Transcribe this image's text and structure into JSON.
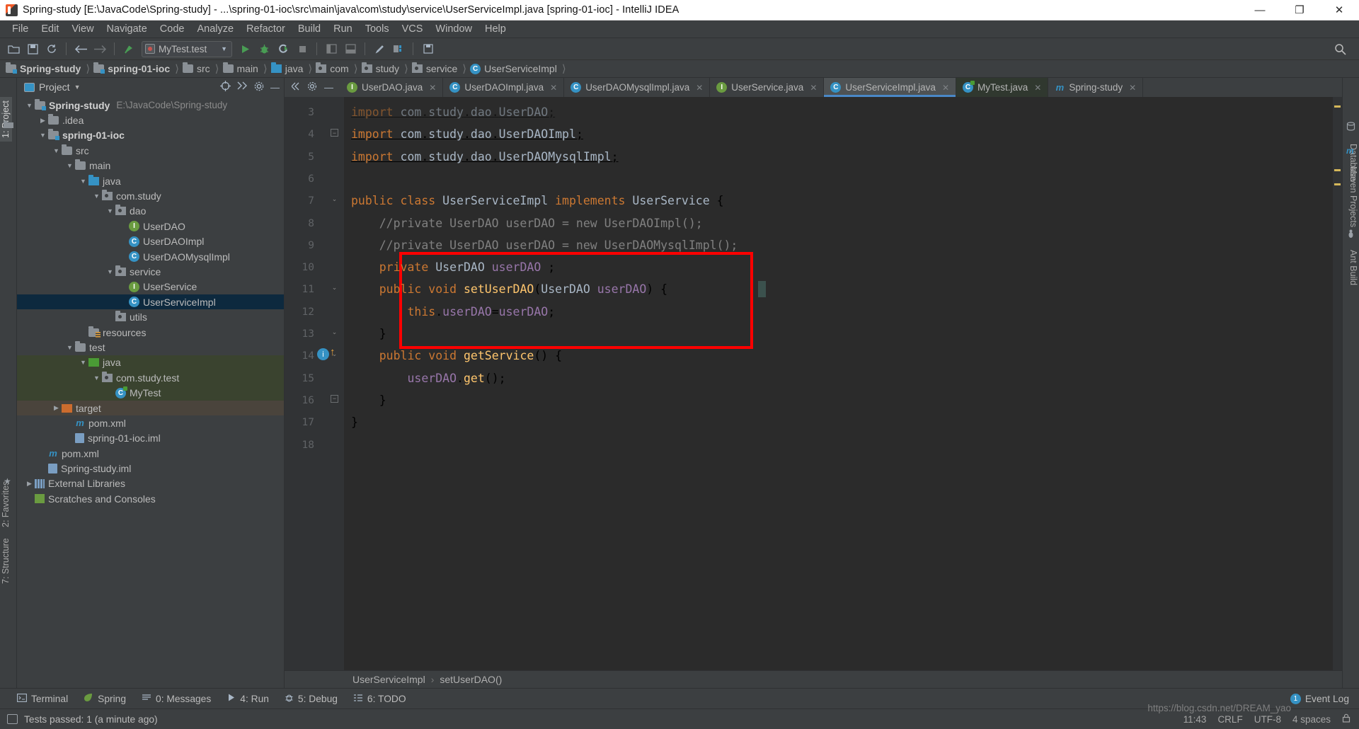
{
  "window": {
    "title": "Spring-study [E:\\JavaCode\\Spring-study] - ...\\spring-01-ioc\\src\\main\\java\\com\\study\\service\\UserServiceImpl.java [spring-01-ioc] - IntelliJ IDEA",
    "minimize": "—",
    "maximize": "❐",
    "close": "✕"
  },
  "menu": [
    "File",
    "Edit",
    "View",
    "Navigate",
    "Code",
    "Analyze",
    "Refactor",
    "Build",
    "Run",
    "Tools",
    "VCS",
    "Window",
    "Help"
  ],
  "toolbar": {
    "open_icon": "open-folder-icon",
    "save_icon": "save-icon",
    "sync_icon": "sync-icon",
    "back_icon": "back-arrow-icon",
    "forward_icon": "forward-arrow-icon",
    "update_icon": "vcs-update-icon",
    "run_config_label": "MyTest.test",
    "run_icon": "run-icon",
    "debug_icon": "debug-icon",
    "coverage_icon": "run-with-coverage-icon",
    "stop_icon": "stop-icon",
    "search_icon": "search-everywhere-icon"
  },
  "navbar": [
    {
      "label": "Spring-study",
      "icon": "module-folder-icon",
      "bold": true
    },
    {
      "label": "spring-01-ioc",
      "icon": "module-folder-icon",
      "bold": true
    },
    {
      "label": "src",
      "icon": "folder-icon",
      "bold": false
    },
    {
      "label": "main",
      "icon": "folder-icon",
      "bold": false
    },
    {
      "label": "java",
      "icon": "source-folder-icon",
      "bold": false
    },
    {
      "label": "com",
      "icon": "package-icon",
      "bold": false
    },
    {
      "label": "study",
      "icon": "package-icon",
      "bold": false
    },
    {
      "label": "service",
      "icon": "package-icon",
      "bold": false
    },
    {
      "label": "UserServiceImpl",
      "icon": "class-icon",
      "bold": false
    }
  ],
  "project_panel": {
    "title": "Project",
    "tree": [
      {
        "indent": 0,
        "twisty": "▼",
        "icon": "module-folder-icon",
        "label": "Spring-study",
        "bold": true,
        "path": "E:\\JavaCode\\Spring-study"
      },
      {
        "indent": 1,
        "twisty": "▶",
        "icon": "folder-icon",
        "label": ".idea",
        "bold": false
      },
      {
        "indent": 1,
        "twisty": "▼",
        "icon": "module-folder-icon",
        "label": "spring-01-ioc",
        "bold": true
      },
      {
        "indent": 2,
        "twisty": "▼",
        "icon": "folder-icon",
        "label": "src",
        "bold": false
      },
      {
        "indent": 3,
        "twisty": "▼",
        "icon": "folder-icon",
        "label": "main",
        "bold": false
      },
      {
        "indent": 4,
        "twisty": "▼",
        "icon": "source-folder-icon",
        "label": "java",
        "bold": false
      },
      {
        "indent": 5,
        "twisty": "▼",
        "icon": "package-icon",
        "label": "com.study",
        "bold": false
      },
      {
        "indent": 6,
        "twisty": "▼",
        "icon": "package-icon",
        "label": "dao",
        "bold": false
      },
      {
        "indent": 7,
        "twisty": "",
        "icon": "interface-icon",
        "label": "UserDAO",
        "bold": false
      },
      {
        "indent": 7,
        "twisty": "",
        "icon": "class-icon",
        "label": "UserDAOImpl",
        "bold": false
      },
      {
        "indent": 7,
        "twisty": "",
        "icon": "class-icon",
        "label": "UserDAOMysqlImpl",
        "bold": false
      },
      {
        "indent": 6,
        "twisty": "▼",
        "icon": "package-icon",
        "label": "service",
        "bold": false
      },
      {
        "indent": 7,
        "twisty": "",
        "icon": "interface-icon",
        "label": "UserService",
        "bold": false
      },
      {
        "indent": 7,
        "twisty": "",
        "icon": "class-icon",
        "label": "UserServiceImpl",
        "bold": false,
        "state": "selected"
      },
      {
        "indent": 6,
        "twisty": "",
        "icon": "package-icon",
        "label": "utils",
        "bold": false
      },
      {
        "indent": 4,
        "twisty": "",
        "icon": "resources-folder-icon",
        "label": "resources",
        "bold": false
      },
      {
        "indent": 3,
        "twisty": "▼",
        "icon": "folder-icon",
        "label": "test",
        "bold": false
      },
      {
        "indent": 4,
        "twisty": "▼",
        "icon": "test-source-folder-icon",
        "label": "java",
        "bold": false,
        "state": "test-scope"
      },
      {
        "indent": 5,
        "twisty": "▼",
        "icon": "package-icon",
        "label": "com.study.test",
        "bold": false,
        "state": "test-scope"
      },
      {
        "indent": 6,
        "twisty": "",
        "icon": "test-class-icon",
        "label": "MyTest",
        "bold": false,
        "state": "test-scope"
      },
      {
        "indent": 2,
        "twisty": "▶",
        "icon": "excluded-folder-icon",
        "label": "target",
        "bold": false,
        "state": "target-scope"
      },
      {
        "indent": 3,
        "twisty": "",
        "icon": "maven-icon",
        "label": "pom.xml",
        "bold": false
      },
      {
        "indent": 3,
        "twisty": "",
        "icon": "iml-file-icon",
        "label": "spring-01-ioc.iml",
        "bold": false
      },
      {
        "indent": 1,
        "twisty": "",
        "icon": "maven-icon",
        "label": "pom.xml",
        "bold": false
      },
      {
        "indent": 1,
        "twisty": "",
        "icon": "iml-file-icon",
        "label": "Spring-study.iml",
        "bold": false
      },
      {
        "indent": 0,
        "twisty": "▶",
        "icon": "library-icon",
        "label": "External Libraries",
        "bold": false
      },
      {
        "indent": 0,
        "twisty": "",
        "icon": "scratches-icon",
        "label": "Scratches and Consoles",
        "bold": false
      }
    ]
  },
  "left_strip": {
    "project_tab": "1: Project",
    "favorites_tab": "2: Favorites",
    "structure_tab": "7: Structure"
  },
  "right_strip": {
    "database_tab": "Database",
    "maven_tab": "Maven Projects",
    "ant_tab": "Ant Build"
  },
  "editor_tabs": [
    {
      "label": "UserDAO.java",
      "icon": "interface-icon",
      "active": false
    },
    {
      "label": "UserDAOImpl.java",
      "icon": "class-icon",
      "active": false
    },
    {
      "label": "UserDAOMysqlImpl.java",
      "icon": "class-icon",
      "active": false
    },
    {
      "label": "UserService.java",
      "icon": "interface-icon",
      "active": false
    },
    {
      "label": "UserServiceImpl.java",
      "icon": "class-icon",
      "active": true
    },
    {
      "label": "MyTest.java",
      "icon": "test-class-icon",
      "active": false
    },
    {
      "label": "Spring-study",
      "icon": "maven-icon",
      "active": false
    }
  ],
  "code": {
    "lines": [
      {
        "n": "3",
        "text": "import com.study.dao.UserDAO;",
        "dim": true
      },
      {
        "n": "4",
        "text": "import com.study.dao.UserDAOImpl;",
        "dim": false
      },
      {
        "n": "5",
        "text": "import com.study.dao.UserDAOMysqlImpl;",
        "dim": false
      },
      {
        "n": "6",
        "text": ""
      },
      {
        "n": "7",
        "text": "public class UserServiceImpl implements UserService {"
      },
      {
        "n": "8",
        "text": "    //private UserDAO userDAO = new UserDAOImpl();"
      },
      {
        "n": "9",
        "text": "    //private UserDAO userDAO = new UserDAOMysqlImpl();"
      },
      {
        "n": "10",
        "text": "    private UserDAO userDAO ;"
      },
      {
        "n": "11",
        "text": "    public void setUserDAO(UserDAO userDAO) {"
      },
      {
        "n": "12",
        "text": "        this.userDAO=userDAO;"
      },
      {
        "n": "13",
        "text": "    }"
      },
      {
        "n": "14",
        "text": "    public void getService() {"
      },
      {
        "n": "15",
        "text": "        userDAO.get();"
      },
      {
        "n": "16",
        "text": "    }"
      },
      {
        "n": "17",
        "text": "}"
      },
      {
        "n": "18",
        "text": ""
      }
    ],
    "annotation": {
      "shape": "rectangle",
      "color": "#ff0000",
      "label": "setter-injection-highlight"
    }
  },
  "editor_breadcrumb": {
    "class": "UserServiceImpl",
    "separator": "›",
    "method": "setUserDAO()"
  },
  "bottom_tools": [
    {
      "label": "Terminal",
      "icon": "terminal-icon"
    },
    {
      "label": "Spring",
      "icon": "spring-leaf-icon"
    },
    {
      "label": "0: Messages",
      "icon": "messages-icon"
    },
    {
      "label": "4: Run",
      "icon": "run-icon"
    },
    {
      "label": "5: Debug",
      "icon": "debug-icon"
    },
    {
      "label": "6: TODO",
      "icon": "todo-icon"
    }
  ],
  "event_log": {
    "label": "Event Log",
    "count": "1"
  },
  "statusbar": {
    "message": "Tests passed: 1 (a minute ago)",
    "position": "11:43",
    "line_sep": "CRLF",
    "encoding": "UTF-8",
    "indent": "4 spaces",
    "lock_icon": "lock-icon"
  },
  "watermark": "https://blog.csdn.net/DREAM_yao",
  "colors": {
    "accent": "#3592c4",
    "selection": "#0d293e",
    "annotation": "#ff0000",
    "keyword": "#cc7832",
    "field": "#9876aa",
    "method": "#ffc66d",
    "comment": "#808080",
    "editor_bg": "#2b2b2b",
    "chrome_bg": "#3c3f41"
  }
}
